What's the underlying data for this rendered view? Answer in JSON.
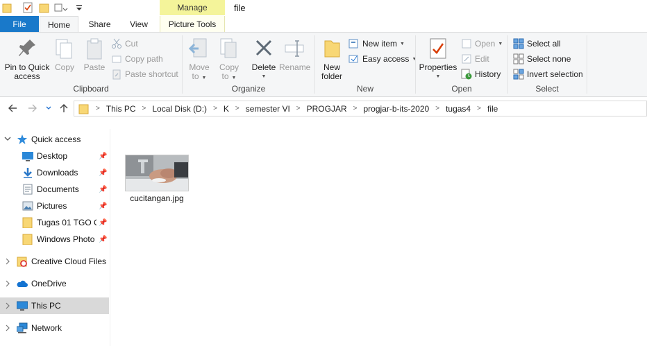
{
  "window": {
    "title": "file",
    "contextual_tab_header": "Manage"
  },
  "tabs": {
    "file": "File",
    "home": "Home",
    "share": "Share",
    "view": "View",
    "picture_tools": "Picture Tools"
  },
  "ribbon": {
    "clipboard": {
      "label": "Clipboard",
      "pin_line1": "Pin to Quick",
      "pin_line2": "access",
      "copy": "Copy",
      "paste": "Paste",
      "cut": "Cut",
      "copy_path": "Copy path",
      "paste_shortcut": "Paste shortcut"
    },
    "organize": {
      "label": "Organize",
      "move_to_line1": "Move",
      "move_to_line2": "to",
      "copy_to_line1": "Copy",
      "copy_to_line2": "to",
      "delete": "Delete",
      "rename": "Rename"
    },
    "new": {
      "label": "New",
      "new_folder_line1": "New",
      "new_folder_line2": "folder",
      "new_item": "New item",
      "easy_access": "Easy access"
    },
    "open": {
      "label": "Open",
      "properties": "Properties",
      "open": "Open",
      "edit": "Edit",
      "history": "History"
    },
    "select": {
      "label": "Select",
      "select_all": "Select all",
      "select_none": "Select none",
      "invert_selection": "Invert selection"
    }
  },
  "breadcrumb": [
    "This PC",
    "Local Disk (D:)",
    "K",
    "semester VI",
    "PROGJAR",
    "progjar-b-its-2020",
    "tugas4",
    "file"
  ],
  "nav": {
    "quick_access": "Quick access",
    "desktop": "Desktop",
    "downloads": "Downloads",
    "documents": "Documents",
    "pictures": "Pictures",
    "tugas": "Tugas 01 TGO C (",
    "windows_photo": "Windows Photo",
    "creative_cloud": "Creative Cloud Files",
    "onedrive": "OneDrive",
    "this_pc": "This PC",
    "network": "Network"
  },
  "files": [
    {
      "name": "cucitangan.jpg"
    }
  ],
  "colors": {
    "file_tab": "#1979ca",
    "manage_tab": "#f4f49a",
    "selected_nav": "#d9d9d9",
    "folder": "#f8d775"
  }
}
